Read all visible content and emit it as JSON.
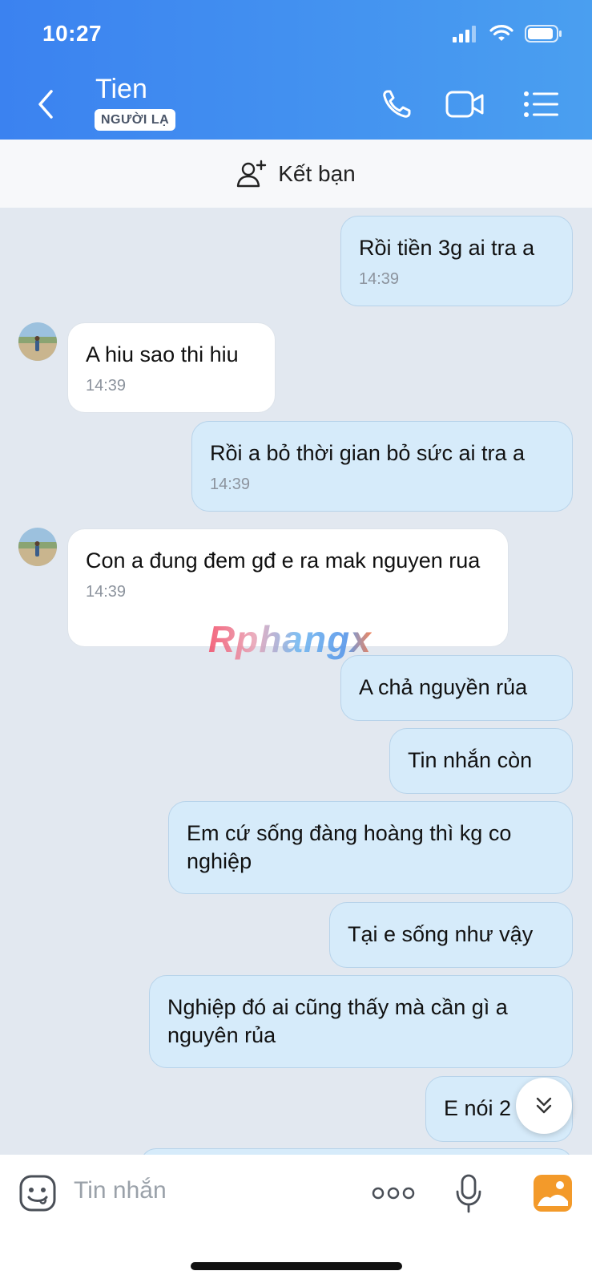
{
  "status": {
    "time": "10:27"
  },
  "header": {
    "title": "Tien",
    "badge": "NGƯỜI LẠ"
  },
  "friend_bar": {
    "label": "Kết bạn"
  },
  "messages": [
    {
      "side": "out",
      "text": "Rồi tiền 3g ai tra a",
      "time": "14:39"
    },
    {
      "side": "in",
      "text": "A hiu sao thi hiu",
      "time": "14:39"
    },
    {
      "side": "out",
      "text": "Rồi a bỏ thời gian bỏ sức ai tra a",
      "time": "14:39"
    },
    {
      "side": "in",
      "text": "Con a đung đem gđ e ra mak nguyen rua",
      "time": "14:39"
    },
    {
      "side": "out",
      "text": "A chả nguyền rủa"
    },
    {
      "side": "out",
      "text": "Tin nhắn còn"
    },
    {
      "side": "out",
      "text": "Em cứ sống đàng hoàng thì kg co nghiệp"
    },
    {
      "side": "out",
      "text": "Tại e sống như vậy"
    },
    {
      "side": "out",
      "text": "Nghiệp đó ai cũng thấy mà cần gì a nguyên rủa"
    },
    {
      "side": "out",
      "text": "E nói 2"
    }
  ],
  "watermark": "Rphangx",
  "composer": {
    "placeholder": "Tin nhắn"
  },
  "colors": {
    "header_start": "#3b82f0",
    "header_end": "#4a9ff0",
    "outgoing_bubble": "#d6ebfa",
    "incoming_bubble": "#ffffff",
    "chat_background": "#e2e8f0"
  },
  "icons": [
    "back-icon",
    "phone-icon",
    "video-call-icon",
    "menu-list-icon",
    "add-friend-icon",
    "sticker-icon",
    "more-icon",
    "microphone-icon",
    "gallery-icon",
    "scroll-down-icon"
  ]
}
